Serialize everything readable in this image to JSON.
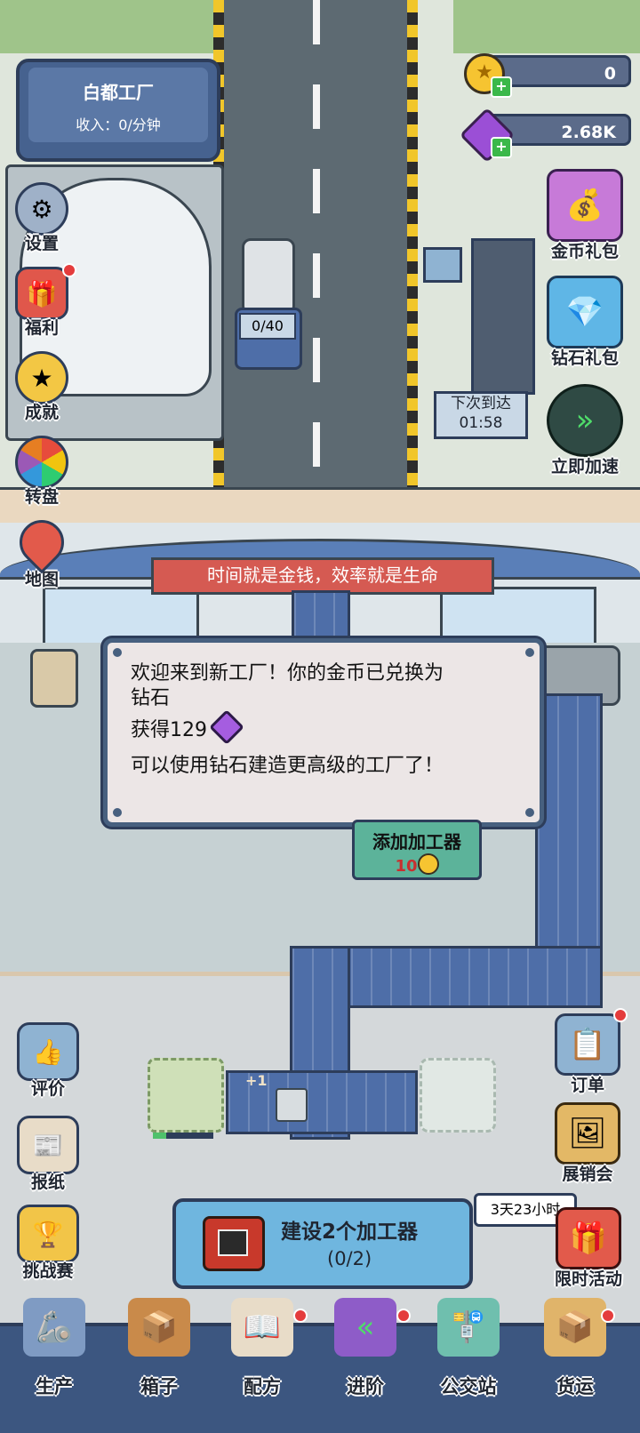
{
  "factory": {
    "name": "白都工厂",
    "income": "收入：0/分钟"
  },
  "resources": {
    "coins": "0",
    "gems": "2.68K"
  },
  "left_menu": [
    {
      "label": "设置",
      "icon": "gear-icon"
    },
    {
      "label": "福利",
      "icon": "gift-icon"
    },
    {
      "label": "成就",
      "icon": "star-badge-icon"
    },
    {
      "label": "转盘",
      "icon": "wheel-icon"
    },
    {
      "label": "地图",
      "icon": "map-pin-icon"
    }
  ],
  "right_menu": [
    {
      "label": "金币礼包",
      "icon": "coin-chest-icon"
    },
    {
      "label": "钻石礼包",
      "icon": "gem-chest-icon"
    },
    {
      "label": "立即加速",
      "icon": "speed-up-icon"
    }
  ],
  "truck": {
    "load": "0/40"
  },
  "arrival": {
    "label": "下次到达",
    "time": "01:58"
  },
  "slogan": "时间就是金钱，效率就是生命",
  "dialog": {
    "line1": "欢迎来到新工厂！你的金币已兑换为",
    "line2": "钻石",
    "reward": "获得129",
    "line3": "可以使用钻石建造更高级的工厂了！"
  },
  "add_processor": {
    "label": "添加加工器",
    "cost": "10"
  },
  "machine_popup": "+1",
  "left_lower_menu": [
    {
      "label": "评价",
      "icon": "thumbs-up-icon"
    },
    {
      "label": "报纸",
      "icon": "newspaper-icon"
    },
    {
      "label": "挑战赛",
      "icon": "trophy-icon"
    }
  ],
  "right_lower_menu": [
    {
      "label": "订单",
      "icon": "clipboard-icon"
    },
    {
      "label": "展销会",
      "icon": "exhibition-icon"
    },
    {
      "label": "限时活动",
      "icon": "limited-gift-icon"
    }
  ],
  "limited_timer": "3天23小时",
  "build_task": {
    "title": "建设2个加工器",
    "progress": "(0/2)"
  },
  "bottom_nav": [
    {
      "label": "生产",
      "icon": "robot-arm-icon"
    },
    {
      "label": "箱子",
      "icon": "crates-icon"
    },
    {
      "label": "配方",
      "icon": "recipe-book-icon"
    },
    {
      "label": "进阶",
      "icon": "upgrade-icon"
    },
    {
      "label": "公交站",
      "icon": "bus-stop-icon"
    },
    {
      "label": "货运",
      "icon": "cargo-icon"
    }
  ]
}
